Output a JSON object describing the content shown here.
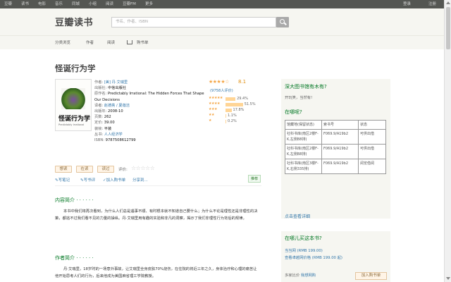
{
  "topbar": {
    "nav": [
      "豆瓣",
      "读书",
      "电影",
      "音乐",
      "同城",
      "小组",
      "阅读",
      "豆瓣FM",
      "更多"
    ],
    "login": "登录",
    "register": "注册"
  },
  "header": {
    "logo": "豆瓣读书",
    "search_placeholder": "书名、作者、ISBN"
  },
  "subnav": [
    "分类浏览",
    "作者",
    "阅读",
    "购书单"
  ],
  "book": {
    "title": "怪诞行为学",
    "cover_title": "怪诞行为学",
    "cover_sub": "Predictably Irrational",
    "info": [
      {
        "k": "作者:",
        "v": "[美] 丹·艾瑞里",
        "link": true
      },
      {
        "k": "出版社:",
        "v": "中信出版社",
        "link": false
      },
      {
        "k": "原作名:",
        "v": "Predictably Irrational: The Hidden Forces That Shape Our Decisions",
        "link": false
      },
      {
        "k": "译者:",
        "v": "赵德亮 / 夏蓓洁",
        "link": true
      },
      {
        "k": "出版年:",
        "v": "2008-10",
        "link": false
      },
      {
        "k": "页数:",
        "v": "262",
        "link": false
      },
      {
        "k": "定价:",
        "v": "39.00",
        "link": false
      },
      {
        "k": "装帧:",
        "v": "平装",
        "link": false
      },
      {
        "k": "丛书:",
        "v": "人人经济学",
        "link": true
      },
      {
        "k": "ISBN:",
        "v": "9787508612799",
        "link": false
      }
    ]
  },
  "rating": {
    "score": "8.1",
    "count": "(9758人评价)",
    "rows": [
      {
        "stars": "★★★★★",
        "pct": "29.4%",
        "frac": 0.294
      },
      {
        "stars": "★★★★",
        "pct": "51.5%",
        "frac": 0.515
      },
      {
        "stars": "★★★",
        "pct": "17.8%",
        "frac": 0.178
      },
      {
        "stars": "★★",
        "pct": "1.1%",
        "frac": 0.011
      },
      {
        "stars": "★",
        "pct": "0.2%",
        "frac": 0.002
      }
    ]
  },
  "actions": {
    "want": "想读",
    "reading": "在读",
    "read": "读过",
    "rate_label": "评价:",
    "write_note": "写笔记",
    "write_review": "写书评",
    "add_to_list": "加入购书单",
    "share": "分享到",
    "recommend": "推荐"
  },
  "intro": {
    "title": "内容简介 · · · · · ·",
    "text": "本书中我们将再次看到，为什么人们总是遇事不顺、有时根本就不知道自己要什么；为什么不论是理性还是非理性的决策，都逃不过我们看不见的力量的操纵。丹·艾瑞里用有趣的实验和非凡的洞察，揭示了我们非理性行为背后的规律。"
  },
  "author_intro": {
    "title": "作者简介 · · · · · ·",
    "text": "丹·艾瑞里，18岁时的一场意外事故，让艾瑞里全身皮肤70%烧伤，在住院的将近三年之久，身体治疗和心理的痛苦让他开始思考人们的行为，后来他成为美国麻省理工学院教授。"
  },
  "library": {
    "title": "深大图书馆有木有?",
    "status": "开玩笑，当然有!"
  },
  "where": {
    "title": "在哪呢?",
    "headers": [
      "馆藏地(保留状态)",
      "索书号",
      "状态"
    ],
    "rows": [
      [
        "社科书库(南区2楼F-K,左侧B8排)",
        "F069.9/A19b2",
        "可供出借"
      ],
      [
        "社科书库(南区2楼F-K,左侧B8排)",
        "F069.9/A19b2",
        "可供出借"
      ],
      [
        "社科书库(南区3楼F-K,右侧335排)",
        "F069.9/A19b2",
        "阅览借阅"
      ]
    ],
    "more": "点击查看详细"
  },
  "buy": {
    "title": "在哪儿买这本书?",
    "store1": "当当网 (RMB 199.00)",
    "store2": "查看卓越网价格 (RMB 199.00 起)",
    "compare": "多家比价",
    "compare_link": "我想网购",
    "add_btn": "加入购书单"
  }
}
